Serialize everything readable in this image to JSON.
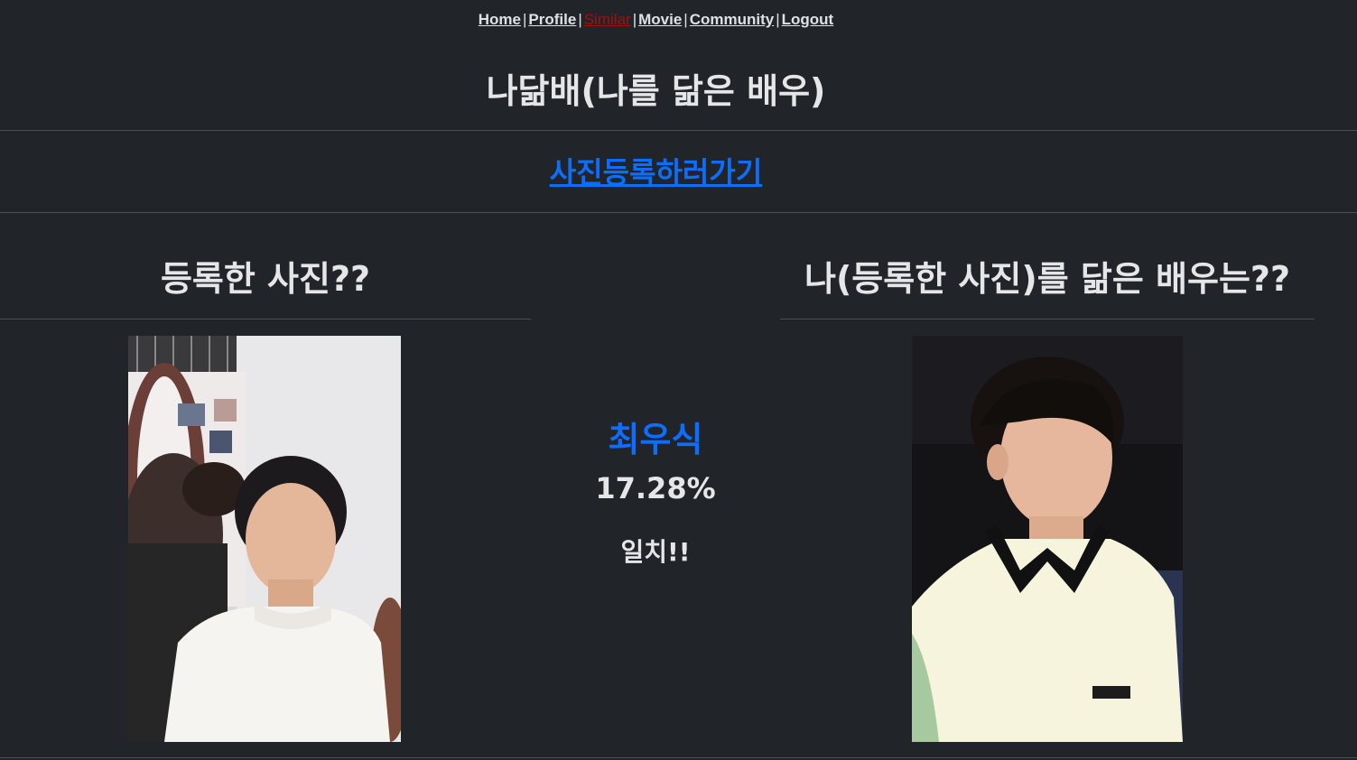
{
  "nav": {
    "items": [
      {
        "label": "Home"
      },
      {
        "label": "Profile"
      },
      {
        "label": "Similar",
        "active": true
      },
      {
        "label": "Movie"
      },
      {
        "label": "Community"
      },
      {
        "label": "Logout"
      }
    ],
    "separator": "|"
  },
  "page": {
    "title": "나닮배(나를 닮은 배우)",
    "upload_link": "사진등록하러가기"
  },
  "left": {
    "heading": "등록한 사진??"
  },
  "right": {
    "heading": "나(등록한 사진)를 닮은 배우는??"
  },
  "result": {
    "actor_name": "최우식",
    "percent": "17.28%",
    "match_text": "일치!!"
  },
  "colors": {
    "background": "#212529",
    "accent": "#0d6efd",
    "active_nav": "#a30f0f"
  }
}
